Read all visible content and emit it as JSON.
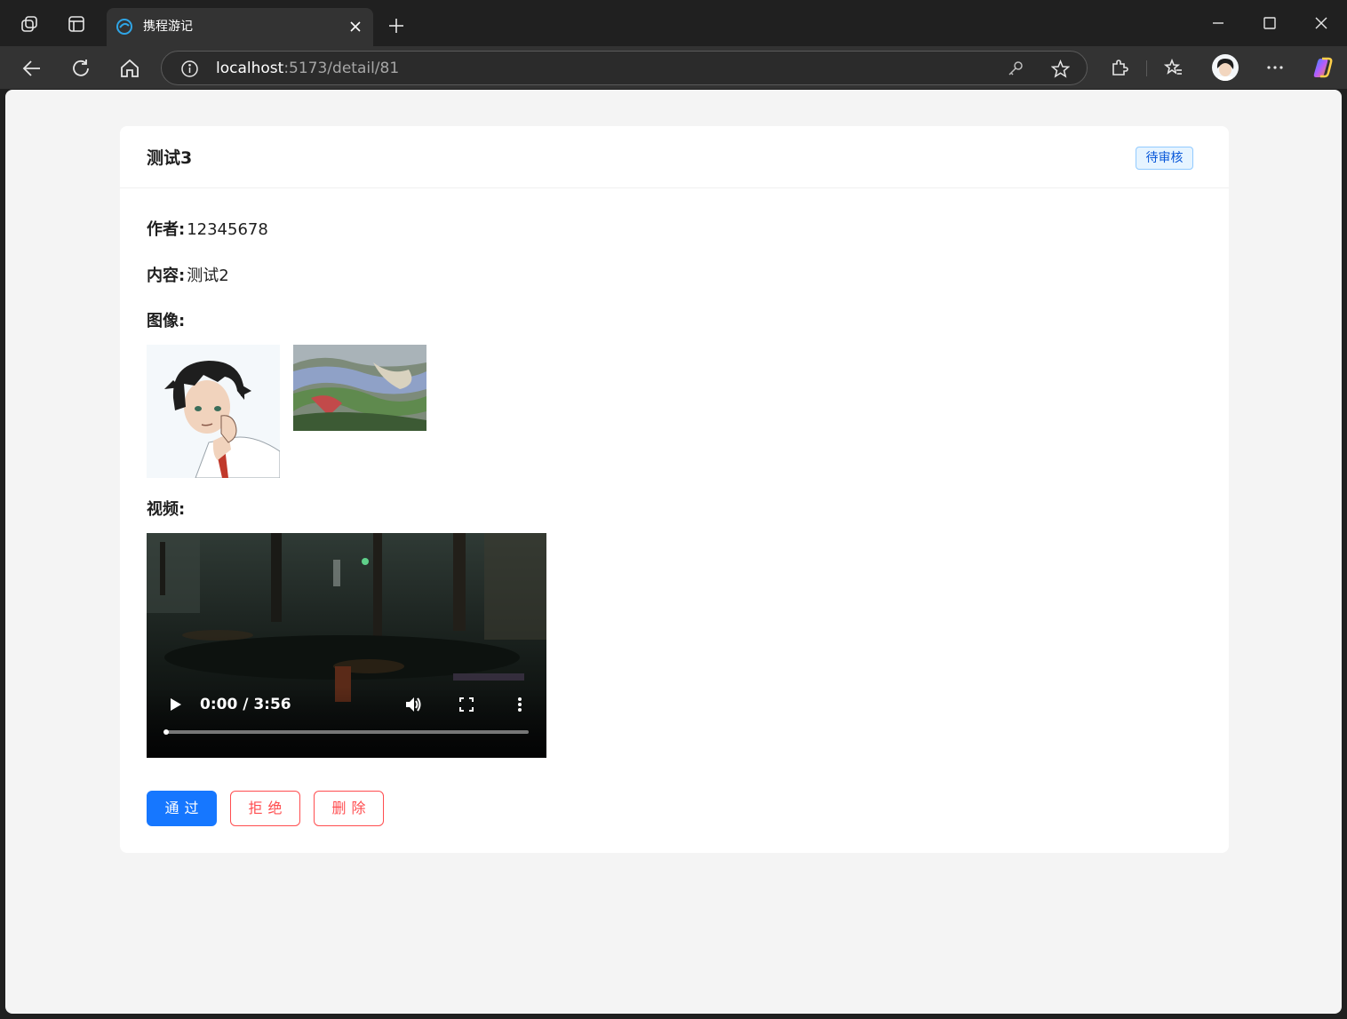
{
  "browser": {
    "tab_title": "携程游记",
    "url_host": "localhost",
    "url_path": ":5173/detail/81",
    "accent_color": "#1677ff"
  },
  "card": {
    "title": "测试3",
    "status": "待审核",
    "author_label": "作者:",
    "author_value": "12345678",
    "content_label": "内容:",
    "content_value": "测试2",
    "images_label": "图像:",
    "video_label": "视频:"
  },
  "video": {
    "time": "0:00 / 3:56",
    "progress": 0
  },
  "actions": {
    "approve": "通过",
    "reject": "拒绝",
    "delete": "删除"
  },
  "colors": {
    "primary": "#1677ff",
    "danger": "#ff4d4f",
    "tag_bg": "#e6f4ff",
    "tag_text": "#0958d9"
  }
}
